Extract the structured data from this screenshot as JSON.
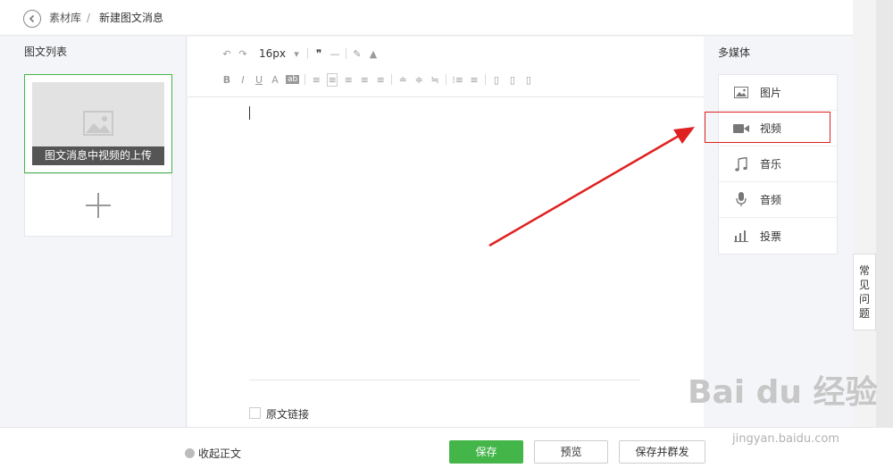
{
  "breadcrumb": {
    "parent": "素材库",
    "separator": "/",
    "current": "新建图文消息"
  },
  "left_panel": {
    "title": "图文列表",
    "article_caption": "图文消息中视频的上传"
  },
  "editor": {
    "font_size": "16px",
    "toolbar_row1": [
      "↶",
      "↷",
      "16px",
      "❞",
      "—",
      "✎",
      "▲"
    ],
    "toolbar_row2": [
      "B",
      "I",
      "U",
      "A",
      "ab",
      "≡",
      "≡",
      "≡",
      "≡",
      "≡",
      "≐",
      "≑",
      "≒",
      "⁝≡",
      "≡",
      "▯",
      "▯",
      "▯"
    ],
    "source_link_label": "原文链接"
  },
  "media_panel": {
    "title": "多媒体",
    "items": [
      {
        "label": "图片",
        "icon": "image-icon"
      },
      {
        "label": "视频",
        "icon": "video-icon"
      },
      {
        "label": "音乐",
        "icon": "music-icon"
      },
      {
        "label": "音频",
        "icon": "microphone-icon"
      },
      {
        "label": "投票",
        "icon": "poll-icon"
      }
    ]
  },
  "faq_tab": {
    "label": [
      "常",
      "见",
      "问",
      "题"
    ]
  },
  "footer": {
    "collapse_label": "收起正文",
    "save_label": "保存",
    "preview_label": "预览",
    "save_send_label": "保存并群发"
  },
  "watermark": {
    "text": "Bai du 经验",
    "url": "jingyan.baidu.com"
  },
  "colors": {
    "accent_green": "#44b549",
    "annotation_red": "#e02020"
  }
}
